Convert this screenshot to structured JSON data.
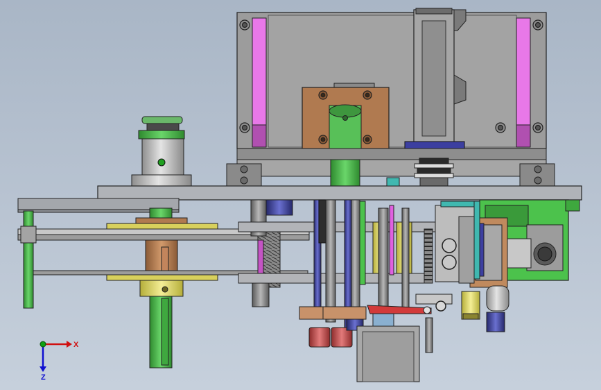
{
  "viewport": {
    "background_top": "#a9b6c6",
    "background_bottom": "#c6d0dc"
  },
  "triad": {
    "x_label": "X",
    "z_label": "Z",
    "x_color": "#d01010",
    "y_color": "#10a010",
    "z_color": "#1010d0"
  },
  "colors": {
    "frame_gray": "#9a9a9a",
    "plate_gray": "#b4b6ba",
    "magenta": "#e060e0",
    "brown": "#b07a50",
    "green": "#4cc24c",
    "yellow": "#e8e06a",
    "navy": "#3a3f9a",
    "red": "#d03030",
    "salmon": "#c95a5a",
    "teal": "#40b8b0"
  }
}
